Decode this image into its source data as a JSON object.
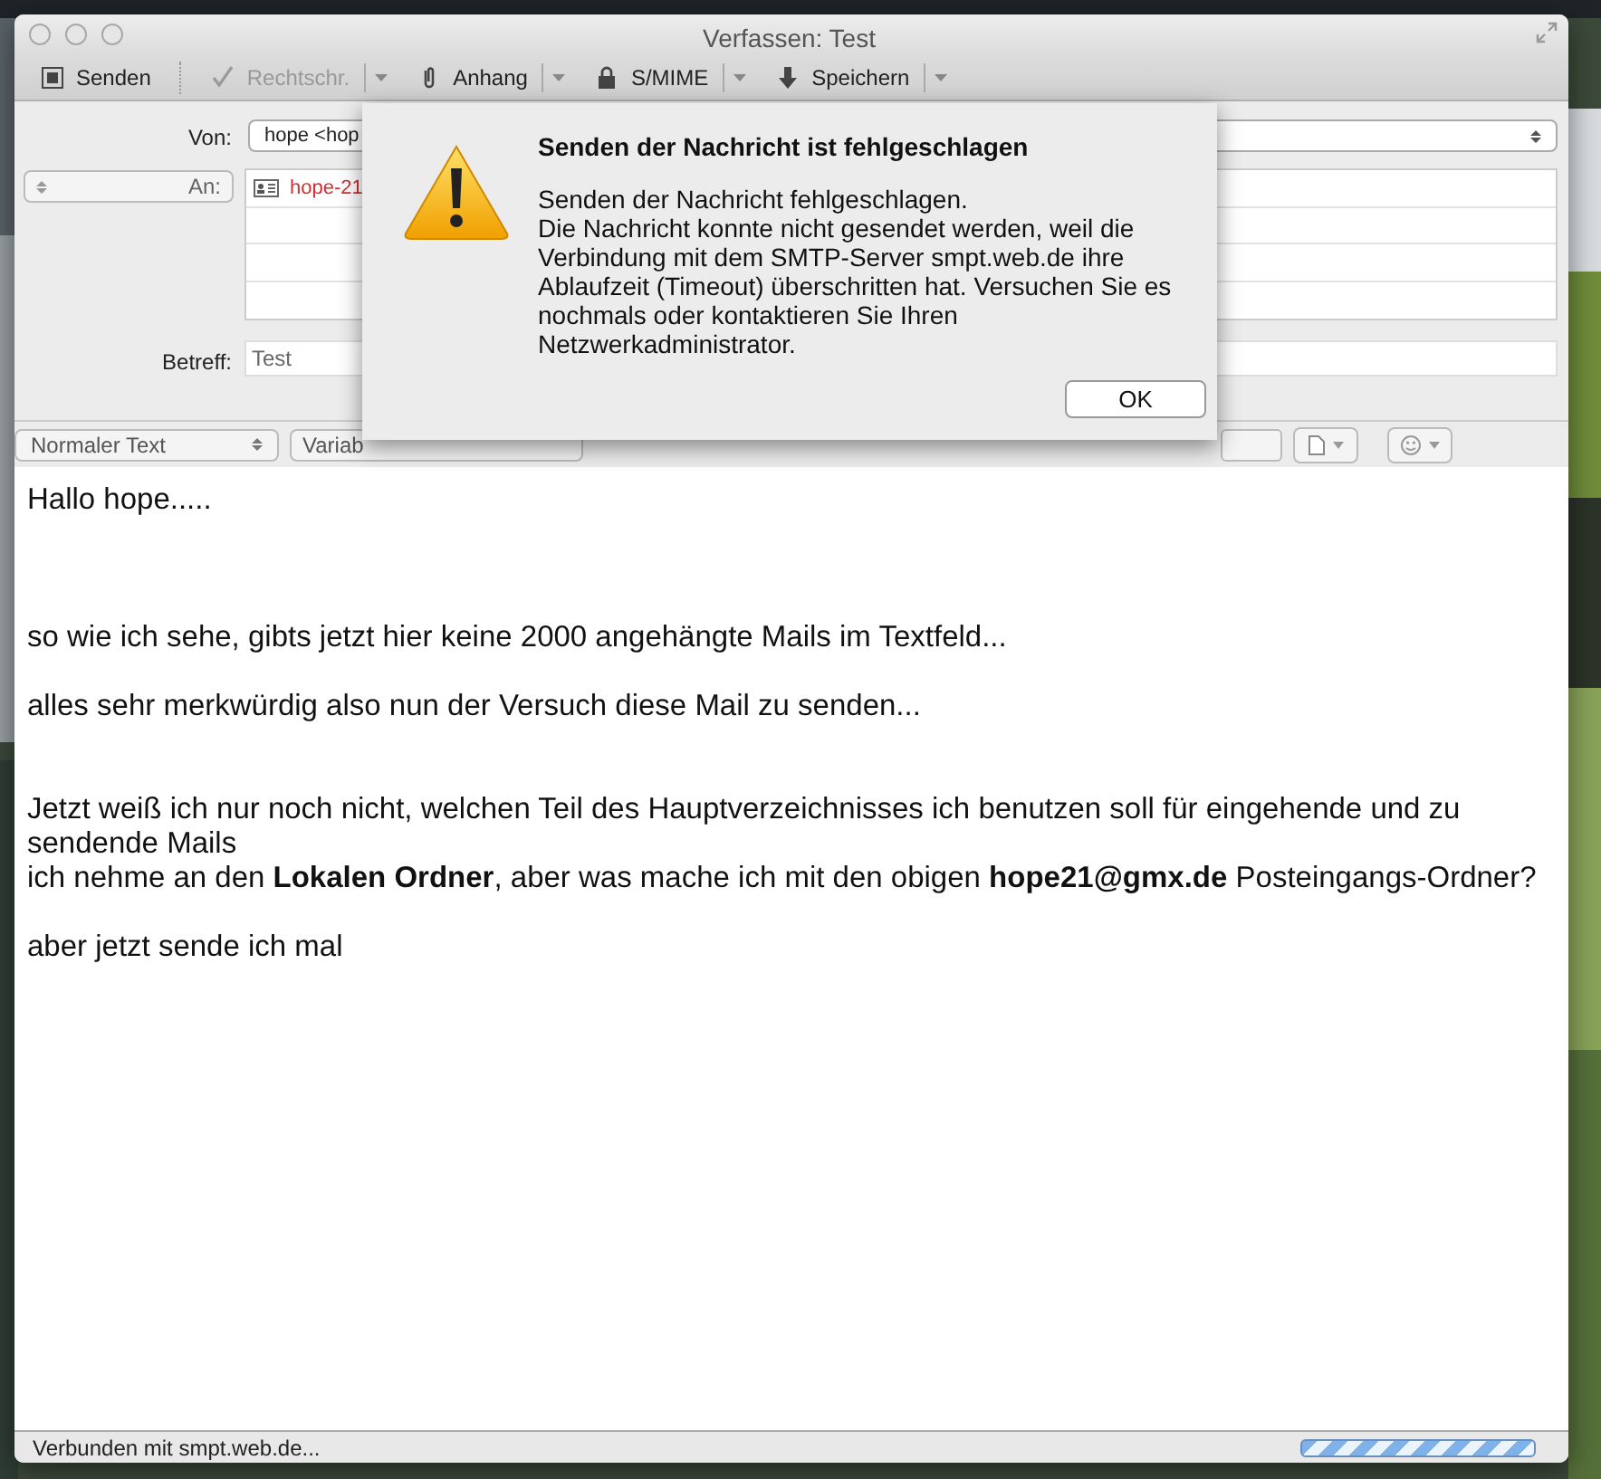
{
  "window": {
    "title": "Verfassen: Test"
  },
  "toolbar": [
    {
      "label": "Senden",
      "kind": "send",
      "disabled": false,
      "dropdown": false
    },
    {
      "label": "Rechtschr.",
      "kind": "spell",
      "disabled": true,
      "dropdown": true
    },
    {
      "label": "Anhang",
      "kind": "attach",
      "disabled": false,
      "dropdown": true
    },
    {
      "label": "S/MIME",
      "kind": "lock",
      "disabled": false,
      "dropdown": true
    },
    {
      "label": "Speichern",
      "kind": "save",
      "disabled": false,
      "dropdown": true
    }
  ],
  "header": {
    "from_label": "Von:",
    "from_value": "hope <hop",
    "to_label": "An:",
    "recipients": [
      "hope-21"
    ],
    "subject_label": "Betreff:",
    "subject_value": "Test"
  },
  "format_bar": {
    "paragraph_style": "Normaler Text",
    "font": "Variab"
  },
  "body": [
    {
      "kind": "line",
      "text": "Hallo hope....."
    },
    {
      "kind": "blank"
    },
    {
      "kind": "blank"
    },
    {
      "kind": "blank"
    },
    {
      "kind": "line",
      "text": "so wie ich sehe, gibts jetzt hier keine 2000 angehängte Mails im Textfeld..."
    },
    {
      "kind": "blank"
    },
    {
      "kind": "line",
      "text": "alles sehr merkwürdig also nun der Versuch diese Mail zu senden..."
    },
    {
      "kind": "blank"
    },
    {
      "kind": "blank"
    },
    {
      "kind": "line",
      "text": "Jetzt weiß ich nur noch nicht, welchen Teil des Hauptverzeichnisses ich benutzen soll für eingehende und zu sendende Mails"
    },
    {
      "kind": "line",
      "text": "ich nehme an den **Lokalen Ordner**, aber was mache ich mit den obigen **hope21@gmx.de** Posteingangs-Ordner?"
    },
    {
      "kind": "blank"
    },
    {
      "kind": "line",
      "text": "aber jetzt sende ich mal"
    }
  ],
  "status_bar": {
    "text": "Verbunden mit smpt.web.de...",
    "progress": {
      "indeterminate": true
    }
  },
  "dialog": {
    "title": "Senden der Nachricht ist fehlgeschlagen",
    "message": [
      "Senden der Nachricht fehlgeschlagen.",
      "Die Nachricht konnte nicht gesendet werden, weil die Verbindung mit dem SMTP-Server smpt.web.de ihre Ablaufzeit (Timeout) überschritten hat. Versuchen Sie es nochmals oder kontaktieren Sie Ihren Netzwerkadministrator."
    ],
    "button": "OK"
  }
}
